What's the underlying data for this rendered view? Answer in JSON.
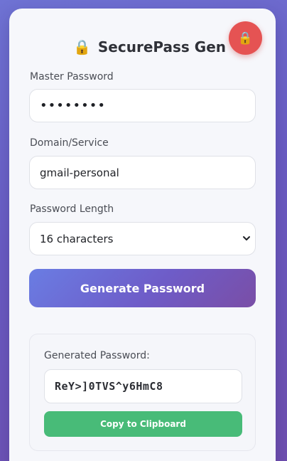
{
  "app": {
    "title": "SecurePass Gen",
    "title_icon": "lock-icon",
    "lock_button_icon": "lock-icon",
    "lock_button_color": "#e55353"
  },
  "form": {
    "master_password_label": "Master Password",
    "master_password_value": "••••••••",
    "domain_label": "Domain/Service",
    "domain_value": "gmail-personal",
    "length_label": "Password Length",
    "length_value": "16 characters",
    "generate_label": "Generate Password"
  },
  "result": {
    "label": "Generated Password:",
    "value": "ReY>]0TVS^y6HmC8",
    "copy_label": "Copy to Clipboard",
    "copy_color": "#48bb78"
  }
}
